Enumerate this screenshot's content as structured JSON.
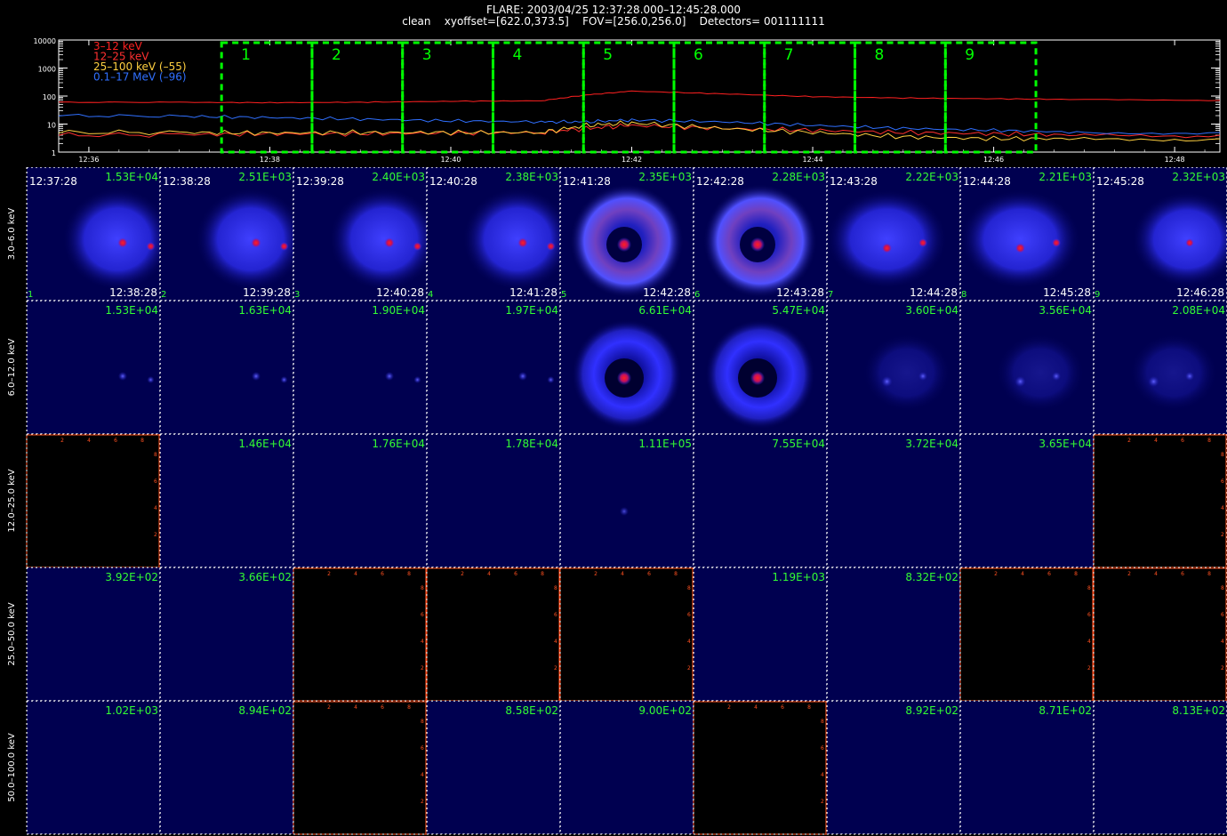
{
  "header": {
    "title_line1": "FLARE: 2003/04/25 12:37:28.000–12:45:28.000",
    "title_line2": "clean    xyoffset=[622.0,373.5]    FOV=[256.0,256.0]    Detectors= 001111111"
  },
  "chart_data": [
    {
      "type": "line",
      "y_scale": "log",
      "ylim": [
        1,
        10000
      ],
      "y_ticks": [
        "10000",
        "1000",
        "100",
        "10",
        "1"
      ],
      "x_ticks": [
        "12:36",
        "12:38",
        "12:40",
        "12:42",
        "12:44",
        "12:46",
        "12:48"
      ],
      "x_range": [
        "12:35:40",
        "12:48:30"
      ],
      "legend": [
        {
          "label": "3–12 keV",
          "color": "#ff2020"
        },
        {
          "label": "12–25 keV",
          "color": "#ff3030"
        },
        {
          "label": "25–100 keV (–55)",
          "color": "#ffd040"
        },
        {
          "label": "0.1–17 MeV (–96)",
          "color": "#3070ff"
        }
      ],
      "series": [
        {
          "name": "3–12 keV",
          "color": "#ff2020",
          "x": [
            "12:35:40",
            "12:37:00",
            "12:38:00",
            "12:39:00",
            "12:40:00",
            "12:41:00",
            "12:41:30",
            "12:42:00",
            "12:43:00",
            "12:44:00",
            "12:45:00",
            "12:46:00",
            "12:47:00",
            "12:48:30"
          ],
          "values": [
            60,
            60,
            58,
            60,
            65,
            68,
            110,
            150,
            120,
            95,
            85,
            80,
            75,
            70
          ]
        },
        {
          "name": "12–25 keV",
          "color": "#ff3030",
          "x": [
            "12:35:40",
            "12:37:00",
            "12:38:00",
            "12:39:00",
            "12:40:00",
            "12:41:00",
            "12:41:30",
            "12:42:00",
            "12:43:00",
            "12:44:00",
            "12:45:00",
            "12:46:00",
            "12:47:00",
            "12:48:30"
          ],
          "values": [
            4,
            4.2,
            4.5,
            4.5,
            4.8,
            5,
            7,
            9,
            7,
            6,
            5,
            4.5,
            4,
            4
          ]
        },
        {
          "name": "25–100 keV (–55)",
          "color": "#ffd040",
          "x": [
            "12:35:40",
            "12:37:00",
            "12:38:00",
            "12:39:00",
            "12:40:00",
            "12:41:00",
            "12:41:30",
            "12:42:00",
            "12:43:00",
            "12:44:00",
            "12:45:00",
            "12:46:00",
            "12:47:00",
            "12:48:30"
          ],
          "values": [
            5,
            5,
            4.8,
            5,
            5,
            5,
            9,
            11,
            7,
            5,
            3.5,
            3,
            3,
            3
          ]
        },
        {
          "name": "0.1–17 MeV (–96)",
          "color": "#3070ff",
          "x": [
            "12:35:40",
            "12:37:00",
            "12:38:00",
            "12:39:00",
            "12:40:00",
            "12:41:00",
            "12:41:30",
            "12:42:00",
            "12:43:00",
            "12:44:00",
            "12:45:00",
            "12:46:00",
            "12:47:00",
            "12:48:30"
          ],
          "values": [
            20,
            19,
            17,
            15,
            13,
            12,
            12,
            14,
            12,
            9,
            7,
            6,
            5,
            5
          ]
        }
      ],
      "intervals": [
        {
          "label": "1",
          "start": "12:37:28",
          "end": "12:38:28"
        },
        {
          "label": "2",
          "start": "12:38:28",
          "end": "12:39:28"
        },
        {
          "label": "3",
          "start": "12:39:28",
          "end": "12:40:28"
        },
        {
          "label": "4",
          "start": "12:40:28",
          "end": "12:41:28"
        },
        {
          "label": "5",
          "start": "12:41:28",
          "end": "12:42:28"
        },
        {
          "label": "6",
          "start": "12:42:28",
          "end": "12:43:28"
        },
        {
          "label": "7",
          "start": "12:43:28",
          "end": "12:44:28"
        },
        {
          "label": "8",
          "start": "12:44:28",
          "end": "12:45:28"
        },
        {
          "label": "9",
          "start": "12:45:28",
          "end": "12:46:28"
        }
      ]
    },
    {
      "type": "heatmap",
      "rows": [
        "3.0–6.0 keV",
        "6.0–12.0 keV",
        "12.0–25.0 keV",
        "25.0–50.0 keV",
        "50.0–100.0 keV"
      ],
      "columns": [
        {
          "index": "1",
          "start": "12:37:28",
          "end": "12:38:28"
        },
        {
          "index": "2",
          "start": "12:38:28",
          "end": "12:39:28"
        },
        {
          "index": "3",
          "start": "12:39:28",
          "end": "12:40:28"
        },
        {
          "index": "4",
          "start": "12:40:28",
          "end": "12:41:28"
        },
        {
          "index": "5",
          "start": "12:41:28",
          "end": "12:42:28"
        },
        {
          "index": "6",
          "start": "12:42:28",
          "end": "12:43:28"
        },
        {
          "index": "7",
          "start": "12:43:28",
          "end": "12:44:28"
        },
        {
          "index": "8",
          "start": "12:44:28",
          "end": "12:45:28"
        },
        {
          "index": "9",
          "start": "12:45:28",
          "end": "12:46:28"
        }
      ],
      "cells": [
        [
          "1.53E+04",
          "2.51E+03",
          "2.40E+03",
          "2.38E+03",
          "2.35E+03",
          "2.28E+03",
          "2.22E+03",
          "2.21E+03",
          "2.32E+03"
        ],
        [
          "1.53E+04",
          "1.63E+04",
          "1.90E+04",
          "1.97E+04",
          "6.61E+04",
          "5.47E+04",
          "3.60E+04",
          "3.56E+04",
          "2.08E+04"
        ],
        [
          "",
          "1.46E+04",
          "1.76E+04",
          "1.78E+04",
          "1.11E+05",
          "7.55E+04",
          "3.72E+04",
          "3.65E+04",
          ""
        ],
        [
          "3.92E+02",
          "3.66E+02",
          "",
          "",
          "",
          "1.19E+03",
          "8.32E+02",
          "",
          ""
        ],
        [
          "1.02E+03",
          "8.94E+02",
          "",
          "8.58E+02",
          "9.00E+02",
          "",
          "8.92E+02",
          "8.71E+02",
          "8.13E+02"
        ]
      ],
      "empty_axis_ticks": [
        "2",
        "4",
        "6",
        "8"
      ],
      "image_styles": [
        [
          "cloud-right",
          "cloud-right",
          "cloud-right",
          "cloud-right",
          "ring-bright",
          "ring-bright",
          "cloud-left",
          "cloud-left",
          "cloud-center"
        ],
        [
          "dots",
          "dots",
          "dots",
          "dots",
          "ring-blue",
          "ring-blue",
          "sparse",
          "sparse",
          "sparse"
        ],
        [
          "empty",
          "dark",
          "dark",
          "dark",
          "dot-dim",
          "dark",
          "dark",
          "dark",
          "empty"
        ],
        [
          "dark",
          "dark",
          "empty",
          "empty",
          "empty",
          "dark",
          "dark",
          "empty",
          "empty"
        ],
        [
          "dark",
          "dark",
          "empty",
          "dark",
          "dark",
          "empty",
          "dark",
          "dark",
          "dark"
        ]
      ]
    }
  ],
  "colors": {
    "background": "#000000",
    "interval_box": "#00ff00",
    "cell_text": "#33ff33",
    "empty_axis": "#ff5020",
    "image_base": "#000050"
  }
}
